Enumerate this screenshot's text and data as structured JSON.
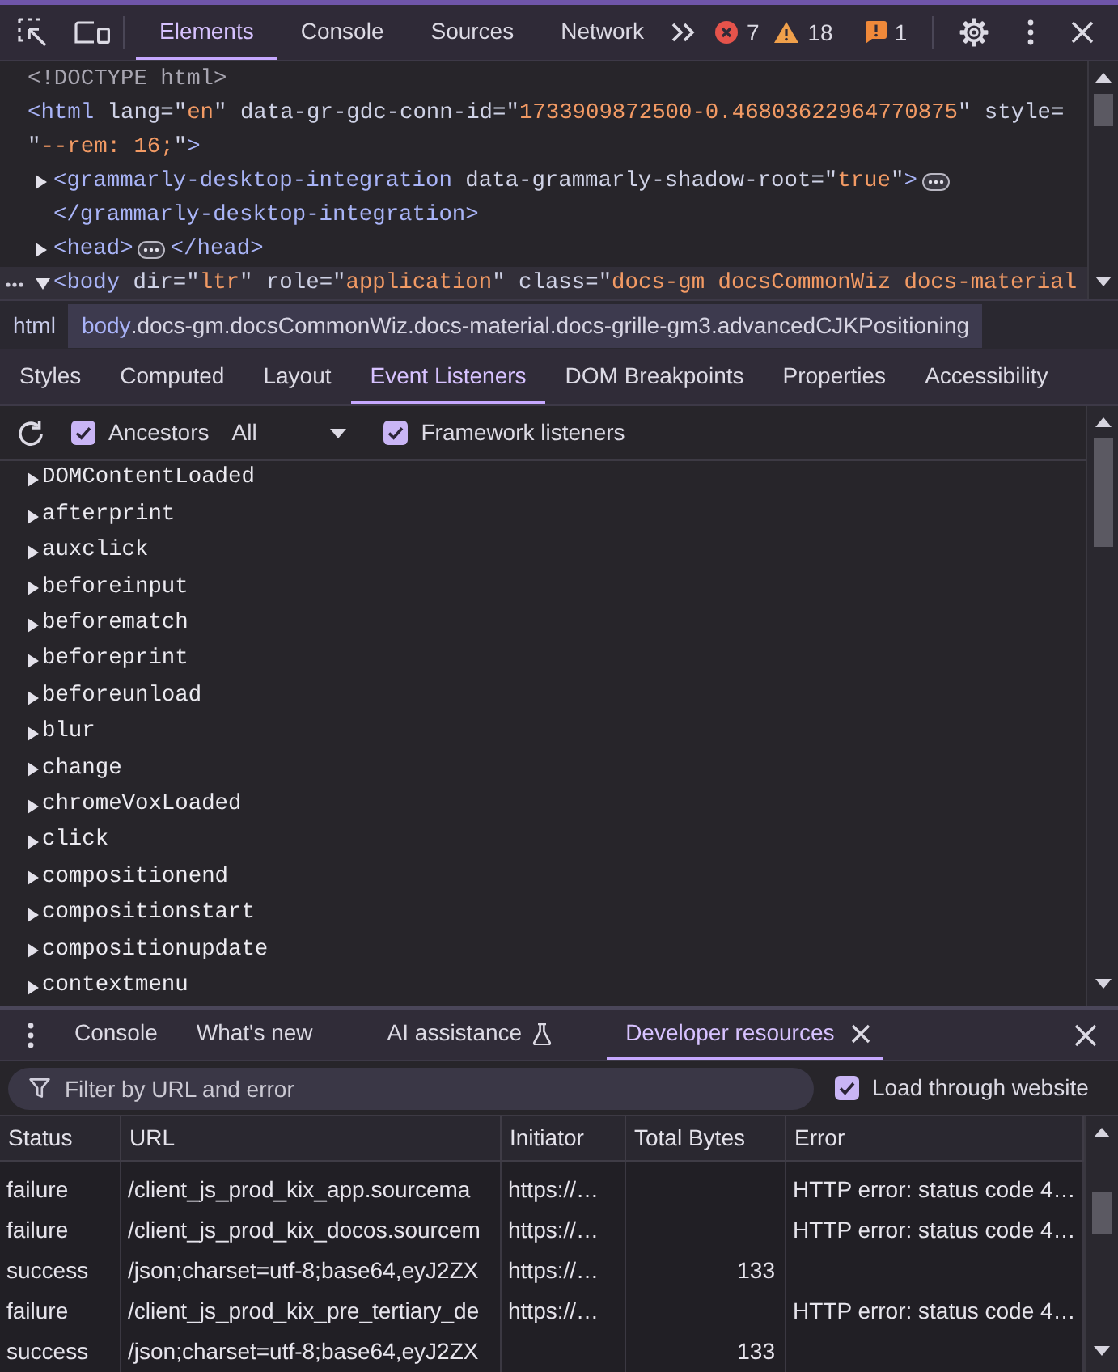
{
  "main_toolbar": {
    "tabs": [
      {
        "label": "Elements",
        "selected": true
      },
      {
        "label": "Console",
        "selected": false
      },
      {
        "label": "Sources",
        "selected": false
      },
      {
        "label": "Network",
        "selected": false
      }
    ],
    "counters": [
      {
        "kind": "error",
        "count": "7"
      },
      {
        "kind": "warning",
        "count": "18"
      },
      {
        "kind": "issue",
        "count": "1"
      }
    ]
  },
  "elements_tree": [
    {
      "selected": false,
      "lines": [
        [
          {
            "kind": "doctype",
            "text": "<!DOCTYPE html>"
          }
        ]
      ]
    },
    {
      "selected": false,
      "lines": [
        [
          {
            "kind": "tag",
            "text": "<html"
          },
          {
            "kind": "attr",
            "text": " lang=\""
          },
          {
            "kind": "value",
            "text": "en"
          },
          {
            "kind": "attr",
            "text": "\" data-gr-gdc-conn-id=\""
          },
          {
            "kind": "value",
            "text": "1733909872500-0.46803622964770875"
          },
          {
            "kind": "attr",
            "text": "\" style="
          }
        ],
        [
          {
            "kind": "attr",
            "text": "\""
          },
          {
            "kind": "value",
            "text": "--rem: 16;"
          },
          {
            "kind": "attr",
            "text": "\""
          },
          {
            "kind": "tag",
            "text": ">"
          }
        ]
      ],
      "children": [
        {
          "expanded": false,
          "selected": false,
          "lines": [
            [
              {
                "kind": "tag",
                "text": "<grammarly-desktop-integration"
              },
              {
                "kind": "attr",
                "text": " data-grammarly-shadow-root=\""
              },
              {
                "kind": "value",
                "text": "true"
              },
              {
                "kind": "attr",
                "text": "\""
              },
              {
                "kind": "tag",
                "text": ">"
              },
              {
                "kind": "ellipsis"
              }
            ],
            [
              {
                "kind": "tag",
                "text": "</grammarly-desktop-integration>"
              }
            ]
          ]
        },
        {
          "expanded": false,
          "selected": false,
          "lines": [
            [
              {
                "kind": "tag",
                "text": "<head>"
              },
              {
                "kind": "ellipsis"
              },
              {
                "kind": "tag",
                "text": "</head>"
              }
            ]
          ]
        },
        {
          "expanded": true,
          "selected": true,
          "lines": [
            [
              {
                "kind": "tag",
                "text": "<body"
              },
              {
                "kind": "attr",
                "text": " dir=\""
              },
              {
                "kind": "value",
                "text": "ltr"
              },
              {
                "kind": "attr",
                "text": "\" role=\""
              },
              {
                "kind": "value",
                "text": "application"
              },
              {
                "kind": "attr",
                "text": "\" class=\""
              },
              {
                "kind": "value",
                "text": "docs-gm docsCommonWiz docs-material"
              }
            ]
          ]
        }
      ]
    }
  ],
  "breadcrumbs": [
    {
      "tag": "html",
      "selected": false
    },
    {
      "tag": "body",
      "classes": ".docs-gm.docsCommonWiz.docs-material.docs-grille-gm3.advancedCJKPositioning",
      "selected": true
    }
  ],
  "sidebar_tabs": [
    {
      "label": "Styles",
      "selected": false
    },
    {
      "label": "Computed",
      "selected": false
    },
    {
      "label": "Layout",
      "selected": false
    },
    {
      "label": "Event Listeners",
      "selected": true
    },
    {
      "label": "DOM Breakpoints",
      "selected": false
    },
    {
      "label": "Properties",
      "selected": false
    },
    {
      "label": "Accessibility",
      "selected": false
    }
  ],
  "event_listeners": {
    "ancestors": {
      "label": "Ancestors",
      "checked": true
    },
    "filter": {
      "value": "All"
    },
    "framework_listeners": {
      "label": "Framework listeners",
      "checked": true
    },
    "events": [
      {
        "name": "DOMContentLoaded",
        "expanded": false
      },
      {
        "name": "afterprint",
        "expanded": false
      },
      {
        "name": "auxclick",
        "expanded": false
      },
      {
        "name": "beforeinput",
        "expanded": false
      },
      {
        "name": "beforematch",
        "expanded": false
      },
      {
        "name": "beforeprint",
        "expanded": false
      },
      {
        "name": "beforeunload",
        "expanded": false
      },
      {
        "name": "blur",
        "expanded": false
      },
      {
        "name": "change",
        "expanded": false
      },
      {
        "name": "chromeVoxLoaded",
        "expanded": false
      },
      {
        "name": "click",
        "expanded": false
      },
      {
        "name": "compositionend",
        "expanded": false
      },
      {
        "name": "compositionstart",
        "expanded": false
      },
      {
        "name": "compositionupdate",
        "expanded": false
      },
      {
        "name": "contextmenu",
        "expanded": false
      }
    ]
  },
  "drawer": {
    "tabs": [
      {
        "label": "Console",
        "selected": false,
        "closable": false,
        "experimental": false
      },
      {
        "label": "What's new",
        "selected": false,
        "closable": true,
        "experimental": false
      },
      {
        "label": "AI assistance",
        "selected": false,
        "closable": true,
        "experimental": true
      },
      {
        "label": "Developer resources",
        "selected": true,
        "closable": true,
        "experimental": false
      }
    ],
    "filter": {
      "placeholder": "Filter by URL and error"
    },
    "load_through_website": {
      "label": "Load through website",
      "checked": true
    },
    "table": {
      "columns": [
        "Status",
        "URL",
        "Initiator",
        "Total Bytes",
        "Error"
      ],
      "rows": [
        {
          "status": "failure",
          "url": "/client_js_prod_kix_app.sourcema",
          "initiator": "https://…",
          "error": "HTTP error: status code 4…"
        },
        {
          "status": "failure",
          "url": "/client_js_prod_kix_docos.sourcem",
          "initiator": "https://…",
          "error": "HTTP error: status code 4…"
        },
        {
          "status": "success",
          "url": "/json;charset=utf-8;base64,eyJ2ZX",
          "initiator": "https://…",
          "total_bytes": "133"
        },
        {
          "status": "failure",
          "url": "/client_js_prod_kix_pre_tertiary_de",
          "initiator": "https://…",
          "error": "HTTP error: status code 4…"
        },
        {
          "status": "success",
          "url": "/json;charset=utf-8;base64,eyJ2ZX",
          "total_bytes": "133"
        }
      ]
    }
  }
}
